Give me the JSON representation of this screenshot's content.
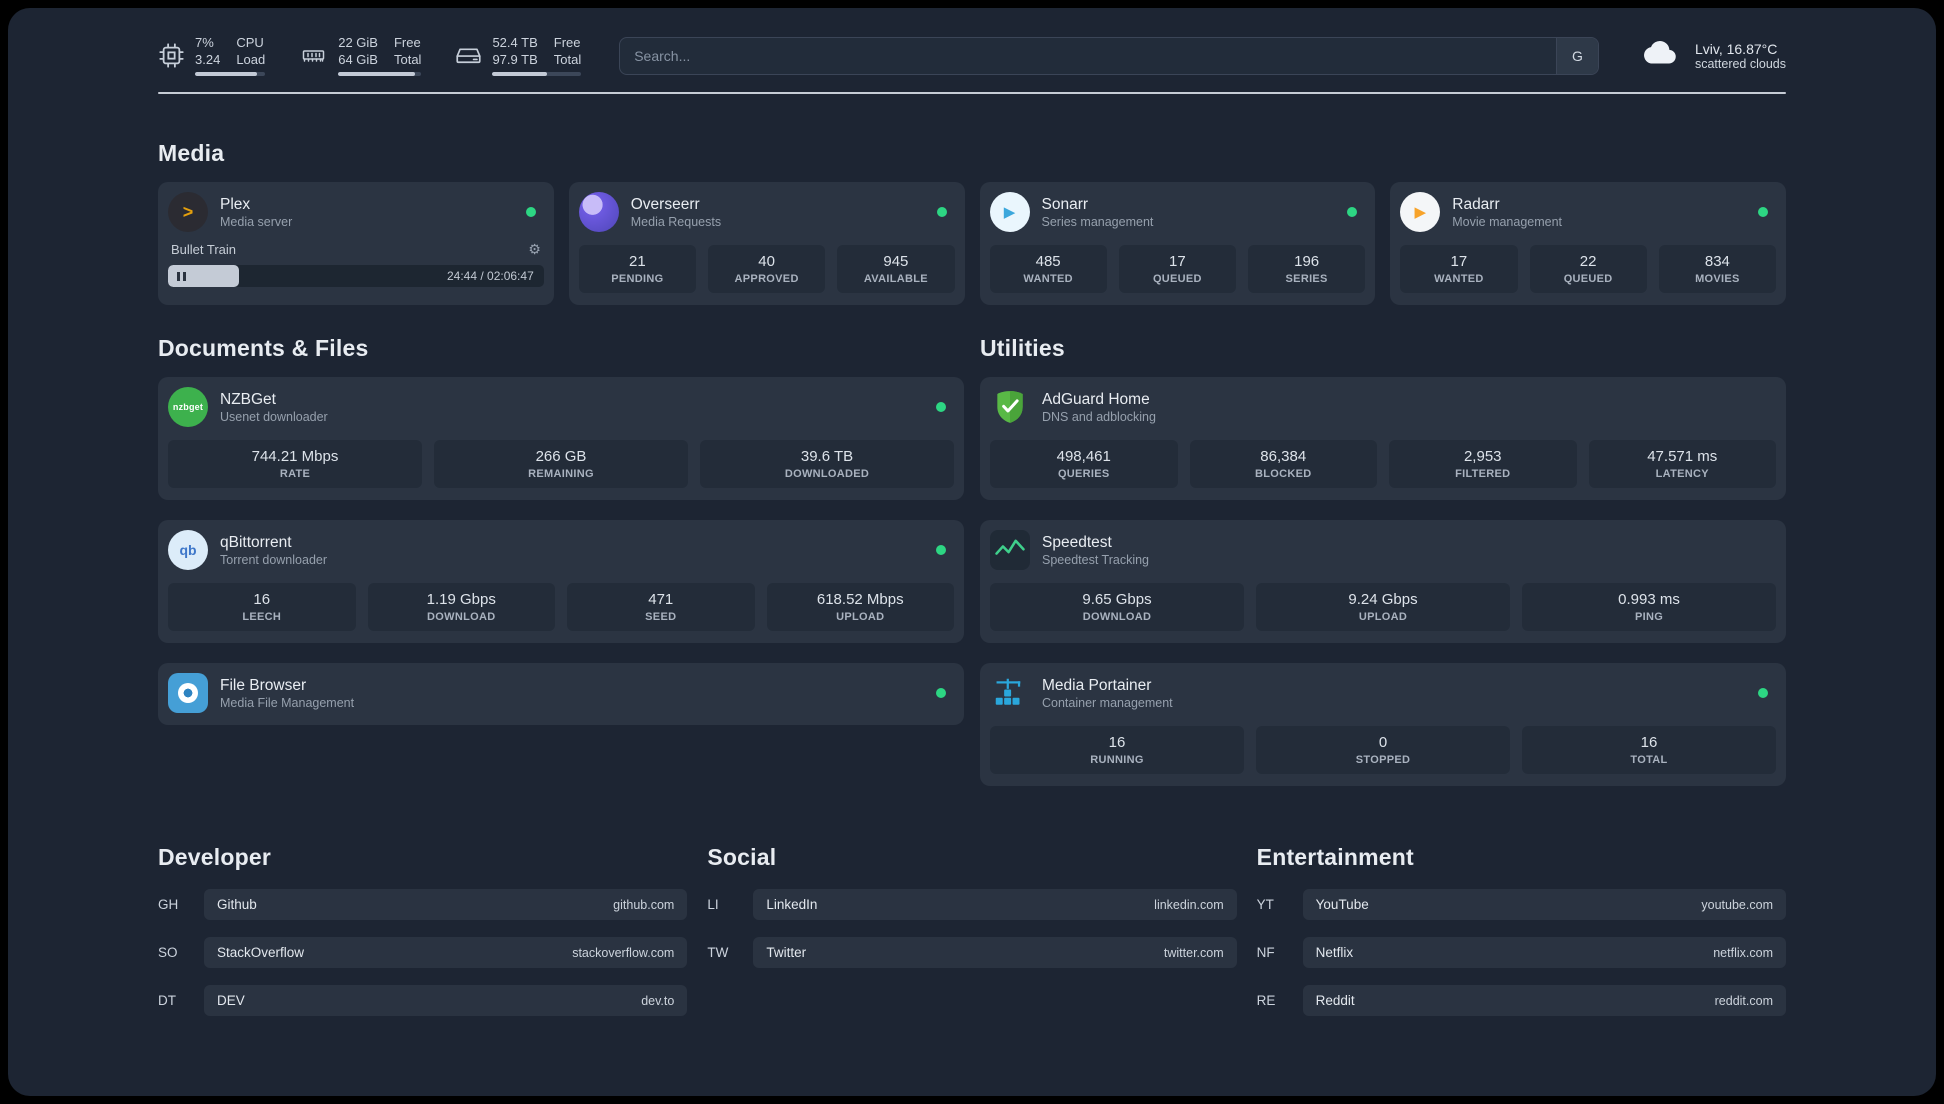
{
  "colors": {
    "background": "#1d2533",
    "card": "#2b3442",
    "stat_box": "#232c39",
    "status_green": "#2dd683",
    "plex_amber": "#e5a00d",
    "portainer_blue": "#2aa7dc",
    "adguard_green": "#59b946"
  },
  "icons": {
    "plex": ">",
    "overseerr": "",
    "sonarr": "▶",
    "radarr": "▶",
    "nzbget": "nzbget",
    "qbittorrent": "qb",
    "gear": "⚙",
    "search_provider": "G"
  },
  "topbar": {
    "cpu": {
      "value_top": "7%",
      "value_bottom": "3.24",
      "label_top": "CPU",
      "label_bottom": "Load",
      "progress": 88
    },
    "memory": {
      "value_top": "22 GiB",
      "value_bottom": "64 GiB",
      "label_top": "Free",
      "label_bottom": "Total",
      "progress": 92
    },
    "disk": {
      "value_top": "52.4 TB",
      "value_bottom": "97.9 TB",
      "label_top": "Free",
      "label_bottom": "Total",
      "progress": 62
    },
    "search": {
      "placeholder": "Search..."
    },
    "weather": {
      "location": "Lviv, 16.87°C",
      "condition": "scattered clouds"
    }
  },
  "groups": {
    "media": {
      "title": "Media",
      "services": [
        {
          "name": "Plex",
          "subtitle": "Media server",
          "player": {
            "track": "Bullet Train",
            "time": "24:44 / 02:06:47",
            "progress": 19
          }
        },
        {
          "name": "Overseerr",
          "subtitle": "Media Requests",
          "stats": [
            {
              "value": "21",
              "label": "PENDING"
            },
            {
              "value": "40",
              "label": "APPROVED"
            },
            {
              "value": "945",
              "label": "AVAILABLE"
            }
          ]
        },
        {
          "name": "Sonarr",
          "subtitle": "Series management",
          "stats": [
            {
              "value": "485",
              "label": "WANTED"
            },
            {
              "value": "17",
              "label": "QUEUED"
            },
            {
              "value": "196",
              "label": "SERIES"
            }
          ]
        },
        {
          "name": "Radarr",
          "subtitle": "Movie management",
          "stats": [
            {
              "value": "17",
              "label": "WANTED"
            },
            {
              "value": "22",
              "label": "QUEUED"
            },
            {
              "value": "834",
              "label": "MOVIES"
            }
          ]
        }
      ]
    },
    "documents": {
      "title": "Documents & Files",
      "services": [
        {
          "name": "NZBGet",
          "subtitle": "Usenet downloader",
          "stats": [
            {
              "value": "744.21 Mbps",
              "label": "RATE"
            },
            {
              "value": "266 GB",
              "label": "REMAINING"
            },
            {
              "value": "39.6 TB",
              "label": "DOWNLOADED"
            }
          ]
        },
        {
          "name": "qBittorrent",
          "subtitle": "Torrent downloader",
          "stats": [
            {
              "value": "16",
              "label": "LEECH"
            },
            {
              "value": "1.19 Gbps",
              "label": "DOWNLOAD"
            },
            {
              "value": "471",
              "label": "SEED"
            },
            {
              "value": "618.52 Mbps",
              "label": "UPLOAD"
            }
          ]
        },
        {
          "name": "File Browser",
          "subtitle": "Media File Management"
        }
      ]
    },
    "utilities": {
      "title": "Utilities",
      "services": [
        {
          "name": "AdGuard Home",
          "subtitle": "DNS and adblocking",
          "stats": [
            {
              "value": "498,461",
              "label": "QUERIES"
            },
            {
              "value": "86,384",
              "label": "BLOCKED"
            },
            {
              "value": "2,953",
              "label": "FILTERED"
            },
            {
              "value": "47.571 ms",
              "label": "LATENCY"
            }
          ]
        },
        {
          "name": "Speedtest",
          "subtitle": "Speedtest Tracking",
          "stats": [
            {
              "value": "9.65 Gbps",
              "label": "DOWNLOAD"
            },
            {
              "value": "9.24 Gbps",
              "label": "UPLOAD"
            },
            {
              "value": "0.993 ms",
              "label": "PING"
            }
          ]
        },
        {
          "name": "Media Portainer",
          "subtitle": "Container management",
          "stats": [
            {
              "value": "16",
              "label": "RUNNING"
            },
            {
              "value": "0",
              "label": "STOPPED"
            },
            {
              "value": "16",
              "label": "TOTAL"
            }
          ]
        }
      ]
    }
  },
  "bookmarks": {
    "developer": {
      "title": "Developer",
      "items": [
        {
          "abbr": "GH",
          "name": "Github",
          "url": "github.com"
        },
        {
          "abbr": "SO",
          "name": "StackOverflow",
          "url": "stackoverflow.com"
        },
        {
          "abbr": "DT",
          "name": "DEV",
          "url": "dev.to"
        }
      ]
    },
    "social": {
      "title": "Social",
      "items": [
        {
          "abbr": "LI",
          "name": "LinkedIn",
          "url": "linkedin.com"
        },
        {
          "abbr": "TW",
          "name": "Twitter",
          "url": "twitter.com"
        }
      ]
    },
    "entertainment": {
      "title": "Entertainment",
      "items": [
        {
          "abbr": "YT",
          "name": "YouTube",
          "url": "youtube.com"
        },
        {
          "abbr": "NF",
          "name": "Netflix",
          "url": "netflix.com"
        },
        {
          "abbr": "RE",
          "name": "Reddit",
          "url": "reddit.com"
        }
      ]
    }
  }
}
